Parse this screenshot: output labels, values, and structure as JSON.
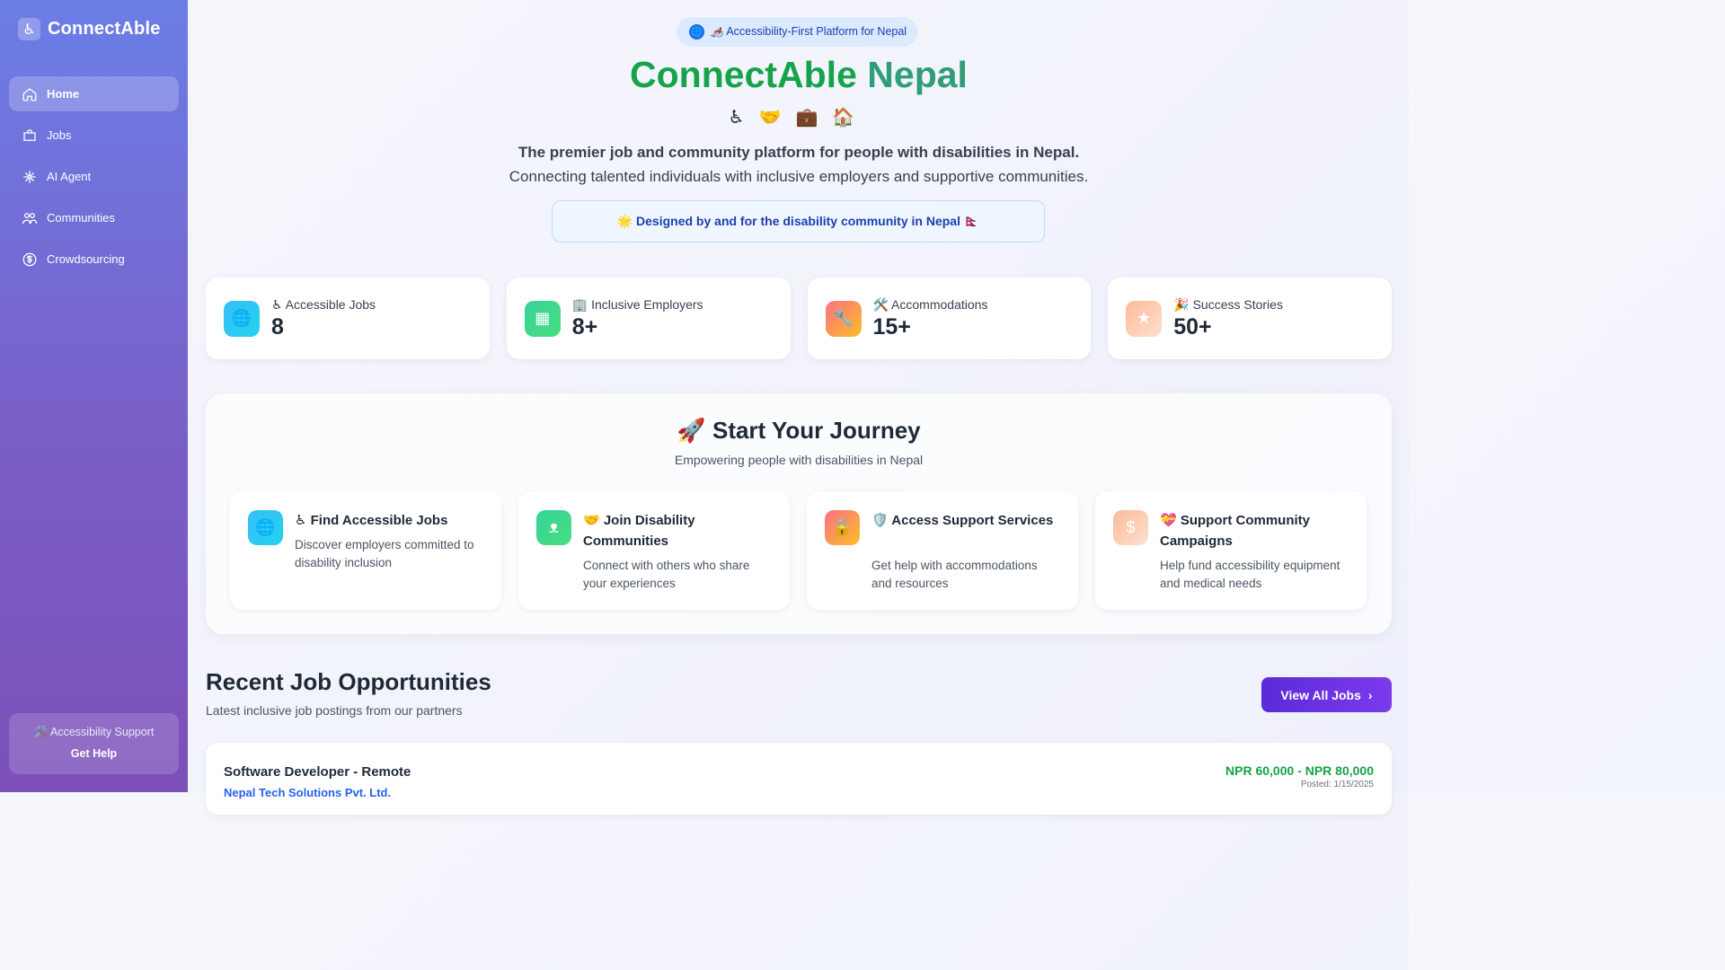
{
  "sidebar": {
    "brand_icon": "♿",
    "brand": "ConnectAble",
    "items": [
      {
        "label": "Home",
        "icon": "home-icon",
        "active": true
      },
      {
        "label": "Jobs",
        "icon": "briefcase-icon"
      },
      {
        "label": "AI Agent",
        "icon": "ai-agent-icon"
      },
      {
        "label": "Communities",
        "icon": "people-icon"
      },
      {
        "label": "Crowdsourcing",
        "icon": "dollar-icon"
      }
    ],
    "support": {
      "title": "🛠️ Accessibility Support",
      "link": "Get Help"
    }
  },
  "hero": {
    "pill": "🦽 Accessibility-First Platform for Nepal",
    "title_part1": "ConnectAble",
    "title_part2": "Nepal",
    "emojis": "♿🤝💼🏠",
    "subtitle_bold": "The premier job and community platform for people with disabilities in Nepal.",
    "subtitle": "Connecting talented individuals with inclusive employers and supportive communities.",
    "designed": "🌟 Designed by and for the disability community in Nepal 🇳🇵"
  },
  "stats": [
    {
      "label": "♿ Accessible Jobs",
      "value": "8",
      "icon": "globe-icon",
      "glyph": "🌐"
    },
    {
      "label": "🏢 Inclusive Employers",
      "value": "8+",
      "icon": "building-icon",
      "glyph": "▦"
    },
    {
      "label": "🛠️ Accommodations",
      "value": "15+",
      "icon": "wrench-icon",
      "glyph": "🔧"
    },
    {
      "label": "🎉 Success Stories",
      "value": "50+",
      "icon": "star-icon",
      "glyph": "★"
    }
  ],
  "journey": {
    "title": "🚀 Start Your Journey",
    "subtitle": "Empowering people with disabilities in Nepal",
    "cards": [
      {
        "title": "♿ Find Accessible Jobs",
        "desc": "Discover employers committed to disability inclusion",
        "icon": "globe-icon",
        "glyph": "🌐"
      },
      {
        "title": "🤝 Join Disability Communities",
        "desc": "Connect with others who share your experiences",
        "icon": "people-icon",
        "glyph": "ᴥ"
      },
      {
        "title": "🛡️ Access Support Services",
        "desc": "Get help with accommodations and resources",
        "icon": "shield-icon",
        "glyph": "🔒"
      },
      {
        "title": "💝 Support Community Campaigns",
        "desc": "Help fund accessibility equipment and medical needs",
        "icon": "dollar-icon",
        "glyph": "$"
      }
    ]
  },
  "recent": {
    "title": "Recent Job Opportunities",
    "subtitle": "Latest inclusive job postings from our partners",
    "view_all": "View All Jobs",
    "jobs": [
      {
        "title": "Software Developer - Remote",
        "company": "Nepal Tech Solutions Pvt. Ltd.",
        "salary": "NPR 60,000 - NPR 80,000",
        "posted": "Posted: 1/15/2025"
      }
    ]
  }
}
